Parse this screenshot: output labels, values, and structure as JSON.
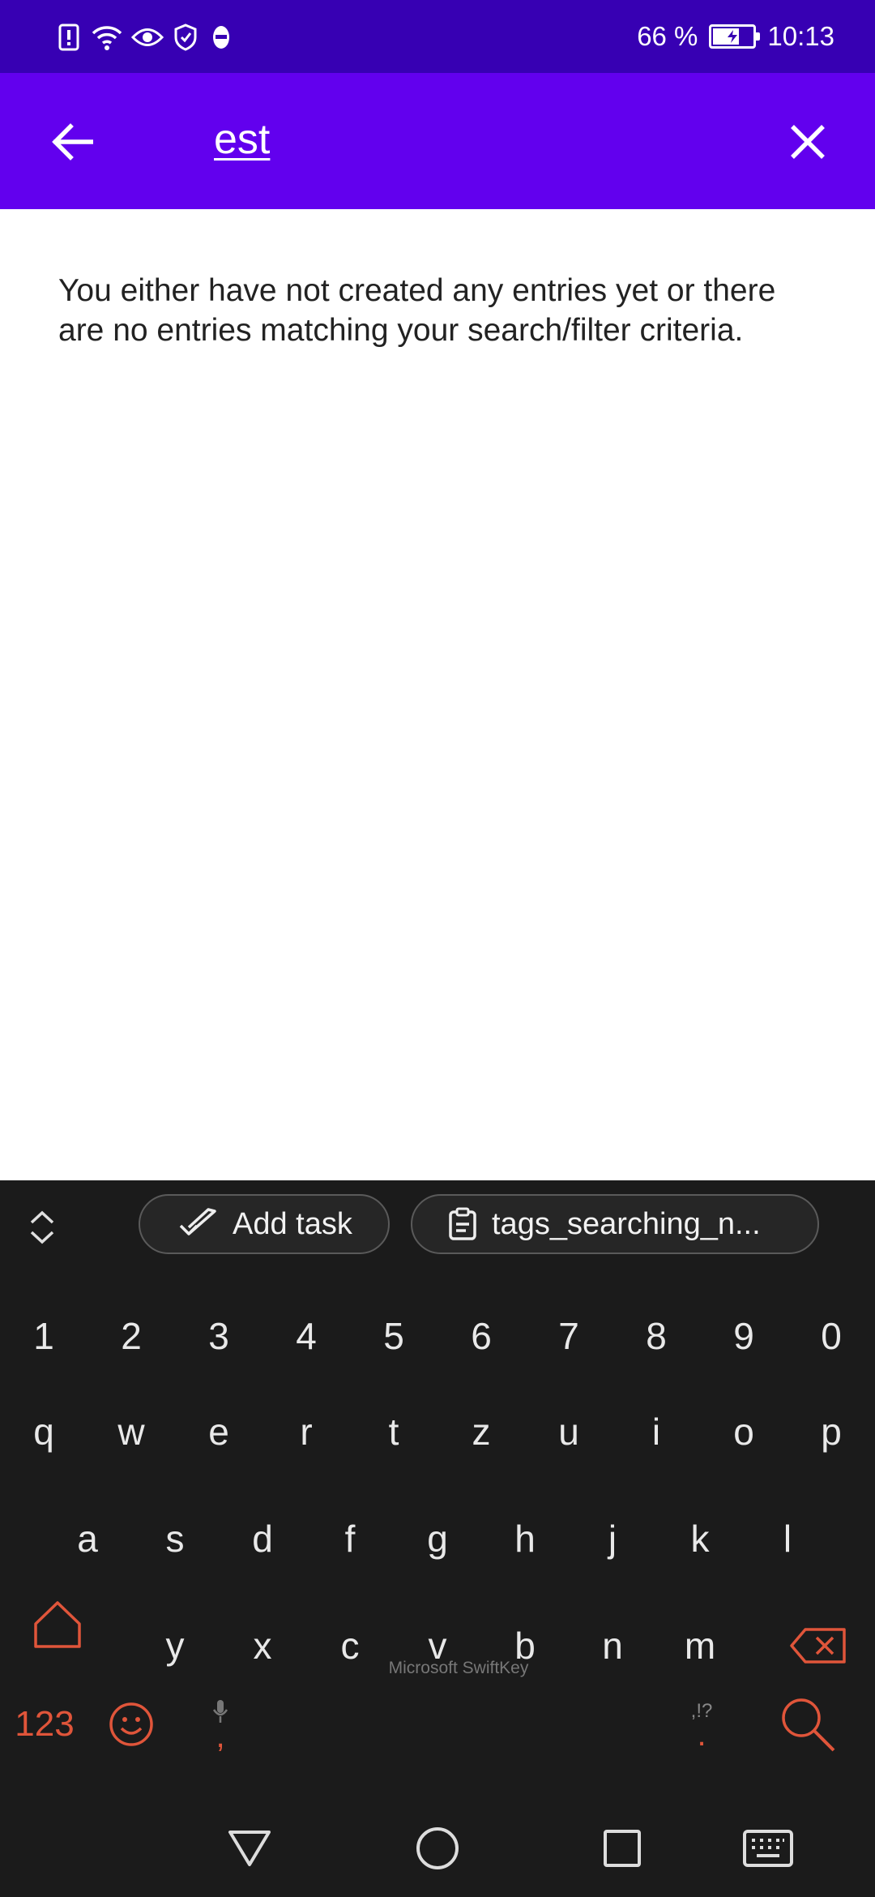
{
  "status_bar": {
    "battery_text": "66 %",
    "battery_level": 0.66,
    "time": "10:13",
    "icons": [
      "alert-icon",
      "wifi-icon",
      "eye-icon",
      "shield-icon",
      "avatar-icon"
    ]
  },
  "app_bar": {
    "search_query": "est",
    "back_icon": "arrow-left-icon",
    "clear_icon": "close-icon",
    "background": "#6200ee"
  },
  "content": {
    "empty_message": "You either have not created any entries yet or there are no entries matching your search/filter criteria."
  },
  "keyboard": {
    "brand": "Microsoft SwiftKey",
    "chips": {
      "add_task": "Add task",
      "clipboard": "tags_searching_n..."
    },
    "number_row": [
      "1",
      "2",
      "3",
      "4",
      "5",
      "6",
      "7",
      "8",
      "9",
      "0"
    ],
    "row1": [
      "q",
      "w",
      "e",
      "r",
      "t",
      "z",
      "u",
      "i",
      "o",
      "p"
    ],
    "row2": [
      "a",
      "s",
      "d",
      "f",
      "g",
      "h",
      "j",
      "k",
      "l"
    ],
    "row3": [
      "y",
      "x",
      "c",
      "v",
      "b",
      "n",
      "m"
    ],
    "bottom": {
      "numbers_label": "123",
      "comma": ",",
      "period": ".",
      "punct_hint": ",!?"
    },
    "accent_color": "#e0553a"
  },
  "nav_bar": {
    "icons": [
      "back-triangle-icon",
      "home-circle-icon",
      "recents-square-icon",
      "keyboard-icon"
    ]
  }
}
